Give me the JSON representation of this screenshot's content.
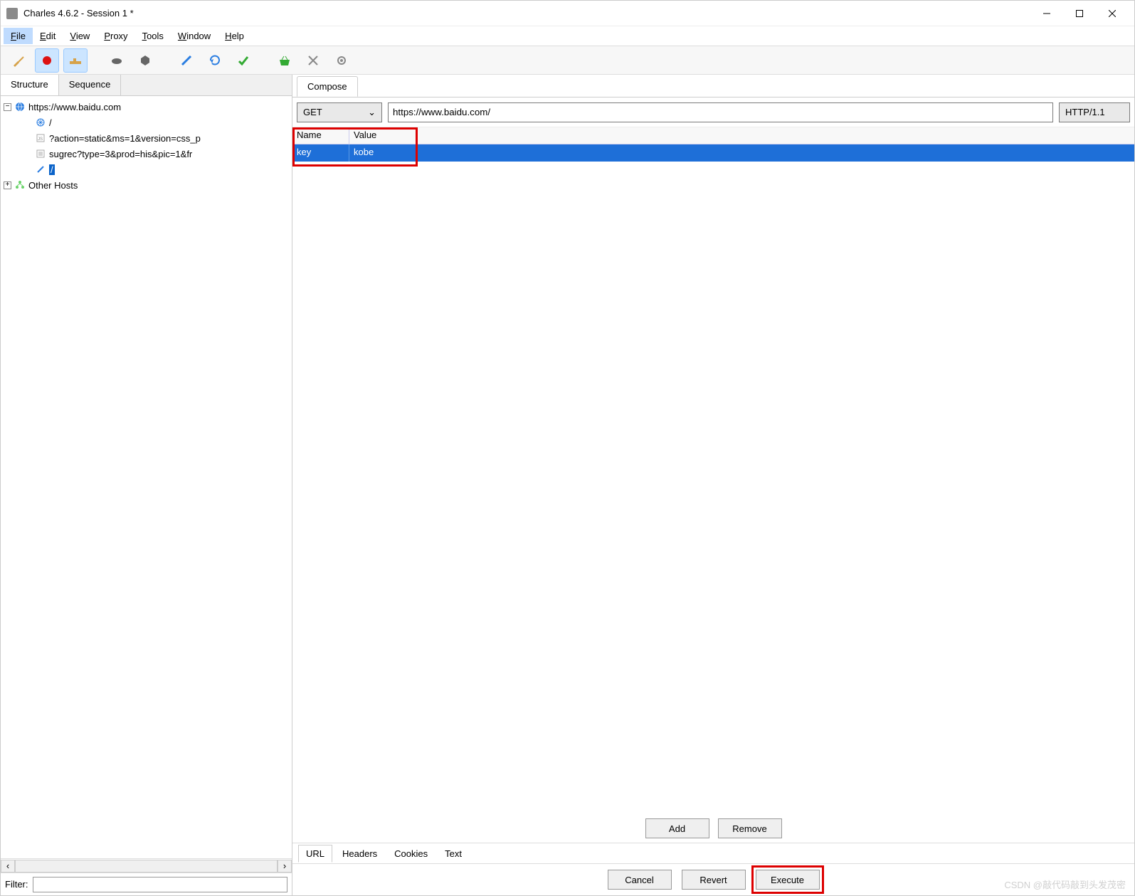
{
  "title": "Charles 4.6.2 - Session 1 *",
  "menubar": [
    "File",
    "Edit",
    "View",
    "Proxy",
    "Tools",
    "Window",
    "Help"
  ],
  "menubar_active": "File",
  "left_tabs": {
    "structure": "Structure",
    "sequence": "Sequence",
    "active": "Structure"
  },
  "tree": {
    "host": "https://www.baidu.com",
    "children": [
      "/",
      "?action=static&ms=1&version=css_p",
      "sugrec?type=3&prod=his&pic=1&fr",
      "/"
    ],
    "other_hosts": "Other Hosts"
  },
  "filter_label": "Filter:",
  "compose_tab": "Compose",
  "request": {
    "method": "GET",
    "url": "https://www.baidu.com/",
    "http_version": "HTTP/1.1"
  },
  "param_headers": {
    "name": "Name",
    "value": "Value"
  },
  "param_row": {
    "name": "key",
    "value": "kobe"
  },
  "buttons": {
    "add": "Add",
    "remove": "Remove",
    "cancel": "Cancel",
    "revert": "Revert",
    "execute": "Execute"
  },
  "sub_tabs": [
    "URL",
    "Headers",
    "Cookies",
    "Text"
  ],
  "sub_tab_active": "URL",
  "watermark": "CSDN @敲代码敲到头发茂密"
}
